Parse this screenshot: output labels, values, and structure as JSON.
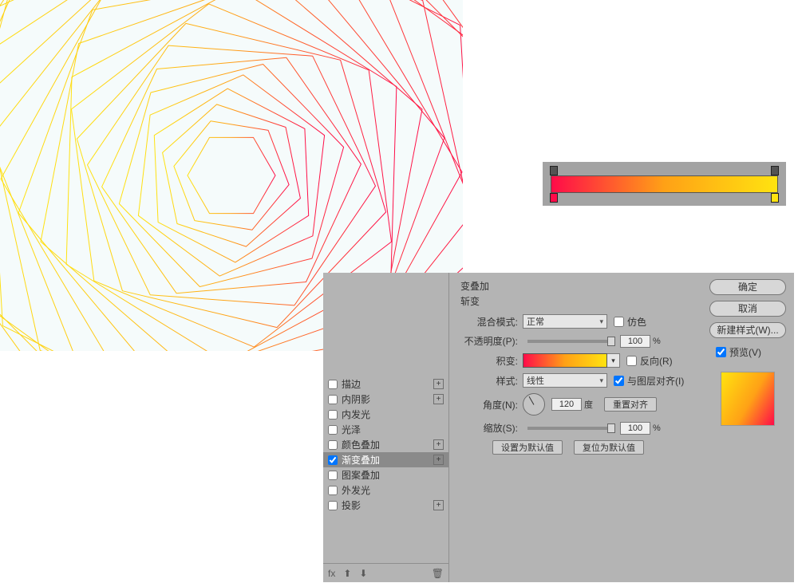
{
  "canvas": {
    "bg": "#f5fbfb"
  },
  "gradient_bar": {
    "colors": {
      "left": "#ff0b49",
      "mid": "#ffa116",
      "right": "#ffe310"
    }
  },
  "dialog": {
    "section_title": "变叠加",
    "section_sub": "斩变",
    "labels": {
      "blend_mode": "混合模式:",
      "opacity": "不透明度(P):",
      "gradient": "积变:",
      "style": "样式:",
      "angle": "角度(N):",
      "scale": "缩放(S):"
    },
    "blend_mode_value": "正常",
    "dither_label": "仿色",
    "opacity_value": "100",
    "pct": "%",
    "reverse_label": "反向(R)",
    "style_value": "线性",
    "align_label": "与图层对齐(I)",
    "angle_value": "120",
    "angle_unit": "度",
    "reset_align": "重置对齐",
    "scale_value": "100",
    "set_default": "设置为默认值",
    "reset_default": "复位为默认值",
    "styles_list": [
      {
        "label": "描边",
        "checked": false,
        "plus": true
      },
      {
        "label": "内阴影",
        "checked": false,
        "plus": true
      },
      {
        "label": "内发光",
        "checked": false,
        "plus": false
      },
      {
        "label": "光泽",
        "checked": false,
        "plus": false
      },
      {
        "label": "颜色叠加",
        "checked": false,
        "plus": true
      },
      {
        "label": "渐变叠加",
        "checked": true,
        "plus": true,
        "selected": true
      },
      {
        "label": "图案叠加",
        "checked": false,
        "plus": false
      },
      {
        "label": "外发光",
        "checked": false,
        "plus": false
      },
      {
        "label": "投影",
        "checked": false,
        "plus": true
      }
    ],
    "footer_fx": "fx",
    "buttons": {
      "ok": "确定",
      "cancel": "取消",
      "new_style": "新建样式(W)...",
      "preview": "预览(V)"
    }
  }
}
